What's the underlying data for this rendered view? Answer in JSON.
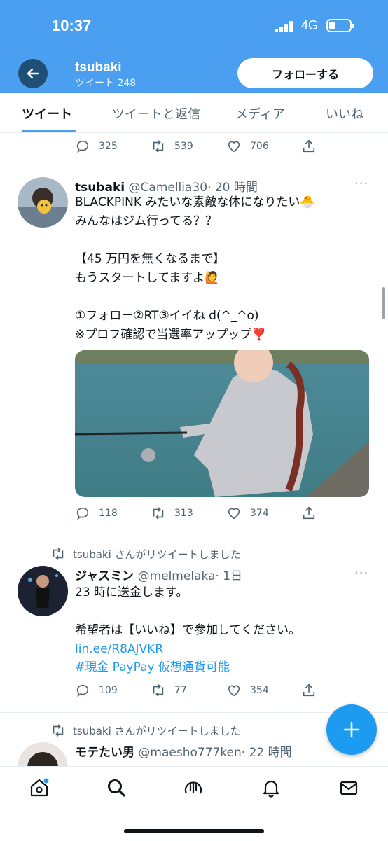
{
  "status": {
    "time": "10:37",
    "network": "4G"
  },
  "header": {
    "name": "tsubaki",
    "tweet_count": "ツイート 248",
    "follow_label": "フォローする"
  },
  "tabs": [
    "ツイート",
    "ツイートと返信",
    "メディア",
    "いいね"
  ],
  "prev_tweet": {
    "replies": "325",
    "retweets": "539",
    "likes": "706"
  },
  "tweet1": {
    "name": "tsubaki",
    "handle": "@Camellia30",
    "time": "· 20 時間",
    "text": "BLACKPINK みたいな素敵な体になりたい🐣\nみんなはジム行ってる？？\n\n【45 万円を無くなるまで】\nもうスタートしてますよ🙋\n\n①フォロー②RT③イイね d(^_^o)\n※プロフ確認で当選率アップップ❣️",
    "replies": "118",
    "retweets": "313",
    "likes": "374"
  },
  "tweet2": {
    "retweeted_by": "tsubaki さんがリツイートしました",
    "name": "ジャスミン",
    "handle": "@melmelaka",
    "time": "· 1日",
    "text": "23 時に送金します。\n\n希望者は【いいね】で参加してください。",
    "link": "lin.ee/R8AJVKR",
    "hashtag": "#現金 PayPay 仮想通貨可能",
    "replies": "109",
    "retweets": "77",
    "likes": "354"
  },
  "tweet3": {
    "retweeted_by": "tsubaki さんがリツイートしました",
    "name": "モテたい男",
    "handle": "@maesho777ken",
    "time": "· 22 時間"
  },
  "colors": {
    "header_bg": "#4a9ff0",
    "accent": "#1d9bf0"
  }
}
